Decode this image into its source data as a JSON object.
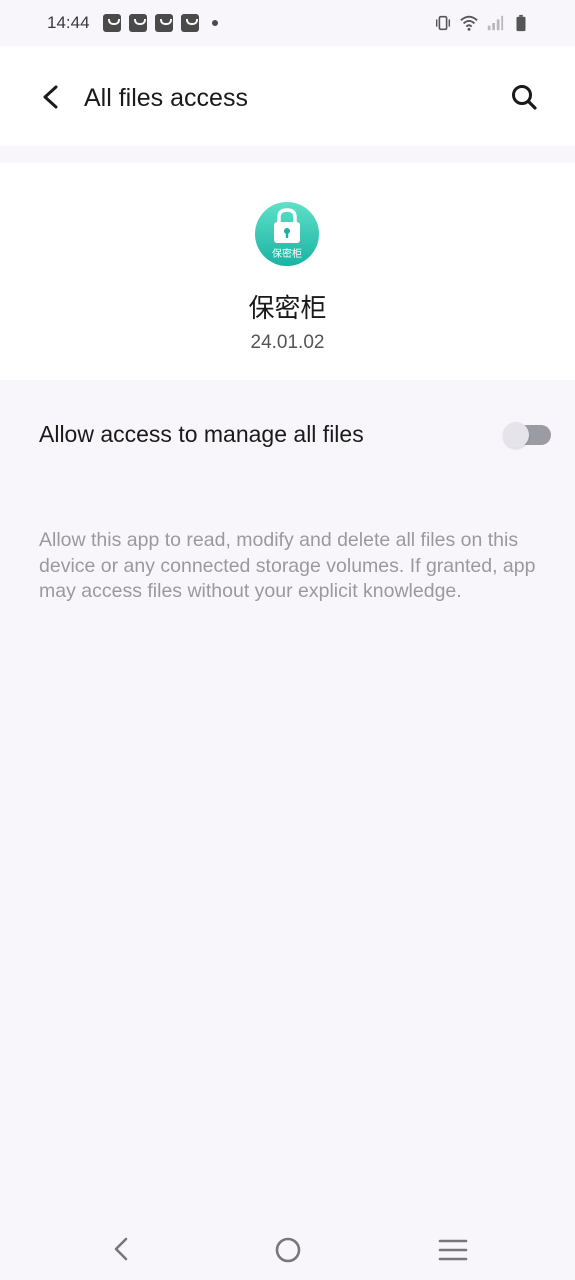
{
  "status_bar": {
    "time": "14:44",
    "notification_icons": [
      "shopping-bag-icon",
      "shopping-bag-icon",
      "shopping-bag-icon",
      "shopping-bag-icon"
    ],
    "system_icons": [
      "vibrate-icon",
      "wifi-icon",
      "signal-icon",
      "battery-icon"
    ]
  },
  "header": {
    "title": "All files access",
    "back_icon": "back-arrow-icon",
    "search_icon": "search-icon"
  },
  "app": {
    "name": "保密柜",
    "version": "24.01.02",
    "icon_label": "保密柜",
    "icon_colors": [
      "#4fd9c6",
      "#1fb8a6"
    ]
  },
  "permission": {
    "label": "Allow access to manage all files",
    "enabled": false,
    "description": "Allow this app to read, modify and delete all files on this device or any connected storage volumes. If granted, app may access files without your explicit knowledge."
  },
  "nav_bar": {
    "icons": [
      "nav-back-icon",
      "nav-home-icon",
      "nav-menu-icon"
    ]
  }
}
